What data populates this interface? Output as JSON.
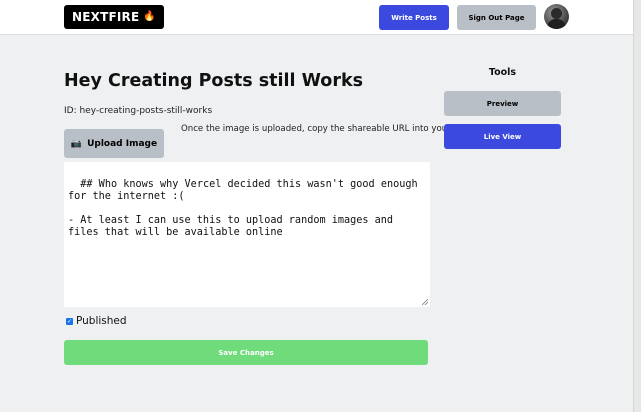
{
  "navbar": {
    "brand": "NEXTFIRE",
    "brand_icon": "🔥",
    "write_posts": "Write Posts",
    "sign_out": "Sign Out Page"
  },
  "post": {
    "title": "Hey Creating Posts still Works",
    "id_label": "ID: hey-creating-posts-still-works",
    "upload_button": "Upload Image",
    "upload_icon": "📷",
    "upload_hint": "Once the image is uploaded, copy the shareable URL into your post!",
    "content": "## Who knows why Vercel decided this wasn't good enough for the internet :(\n\n- At least I can use this to upload random images and files that will be available online",
    "published_label": "Published",
    "published": true,
    "save_button": "Save Changes"
  },
  "tools": {
    "heading": "Tools",
    "preview": "Preview",
    "live_view": "Live View"
  },
  "colors": {
    "primary": "#3b49df",
    "gray": "#b9bfc6",
    "success": "#6fdb7a",
    "background": "#eef0f1"
  }
}
